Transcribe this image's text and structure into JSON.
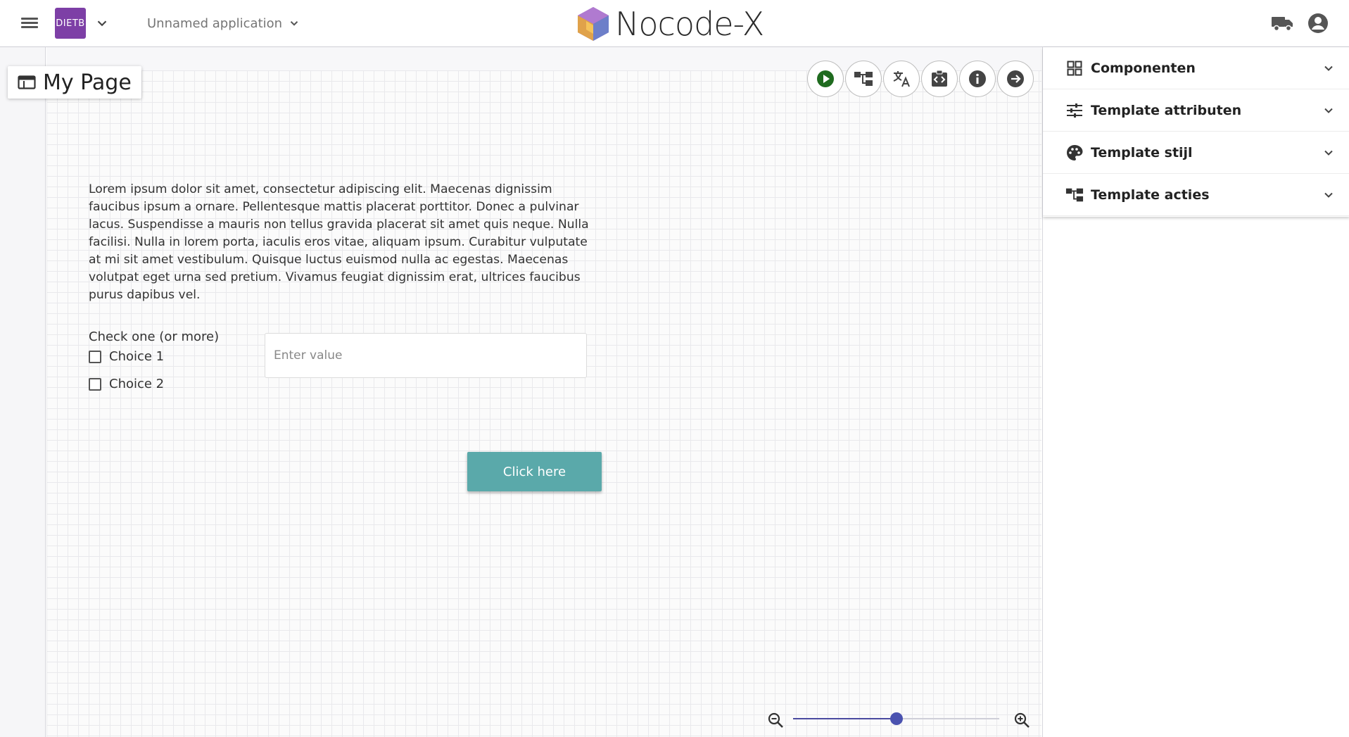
{
  "header": {
    "app_badge": "DIETB",
    "app_name": "Unnamed application",
    "logo_text": "NOCODE-X"
  },
  "page": {
    "title": "My Page"
  },
  "toolbar": {
    "buttons": [
      "play-icon",
      "tree-icon",
      "translate-icon",
      "code-icon",
      "info-icon",
      "arrow-right-icon"
    ]
  },
  "content": {
    "paragraph": "Lorem ipsum dolor sit amet, consectetur adipiscing elit. Maecenas dignissim faucibus ipsum a ornare. Pellentesque mattis placerat porttitor. Donec a pulvinar lacus. Suspendisse a mauris non tellus gravida placerat sit amet quis neque. Nulla facilisi. Nulla in lorem porta, iaculis eros vitae, aliquam ipsum. Curabitur vulputate at mi sit amet vestibulum. Quisque luctus euismod nulla ac egestas. Maecenas volutpat eget urna sed pretium. Vivamus feugiat dignissim erat, ultrices faucibus purus dapibus vel.",
    "checkbox_label": "Check one (or more)",
    "choices": [
      "Choice 1",
      "Choice 2"
    ],
    "input_placeholder": "Enter value",
    "button_label": "Click here"
  },
  "zoom": {
    "level_fraction": 0.5
  },
  "panel": {
    "sections": [
      {
        "label": "Componenten",
        "icon": "grid-icon"
      },
      {
        "label": "Template attributen",
        "icon": "sliders-icon"
      },
      {
        "label": "Template stijl",
        "icon": "palette-icon"
      },
      {
        "label": "Template acties",
        "icon": "tree-icon"
      }
    ]
  },
  "colors": {
    "accent_button": "#5aa9aa",
    "badge": "#7d3fa6",
    "play_green": "#1f6b1f",
    "slider": "#4a52b0"
  }
}
